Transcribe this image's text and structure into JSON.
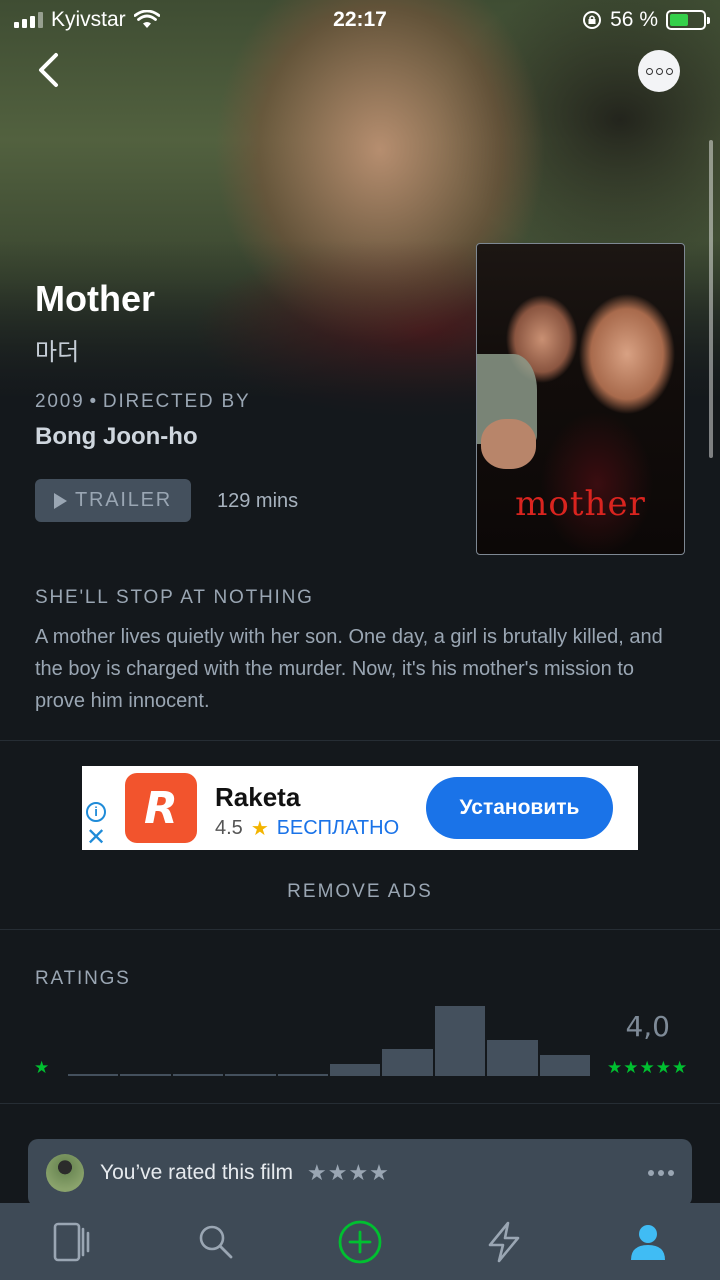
{
  "status_bar": {
    "carrier": "Kyivstar",
    "time": "22:17",
    "battery_percent": "56 %",
    "battery_level": 0.56
  },
  "film": {
    "title": "Mother",
    "original_title": "마더",
    "year": "2009",
    "directed_by_label": "DIRECTED BY",
    "director": "Bong Joon-ho",
    "trailer_label": "TRAILER",
    "runtime": "129 mins",
    "poster_title": "mother",
    "tagline": "SHE'LL STOP AT NOTHING",
    "synopsis": "A mother lives quietly with her son. One day, a girl is brutally killed, and the boy is charged with the murder. Now, it's his mother's mission to prove him innocent."
  },
  "ad": {
    "app_name": "Raketa",
    "rating": "4.5",
    "price": "БЕСПЛАТНО",
    "cta": "Установить",
    "info_icon": "info-icon",
    "close_icon": "close-icon",
    "remove_ads_label": "REMOVE ADS"
  },
  "ratings": {
    "label": "RATINGS",
    "average": "4,0",
    "min_stars": "★",
    "max_stars": "★★★★★",
    "histogram_levels": [
      0.02,
      0.02,
      0.02,
      0.02,
      0.02,
      0.17,
      0.38,
      1.0,
      0.52,
      0.3
    ]
  },
  "user_rating": {
    "text": "You’ve rated this film",
    "stars": "★★★★"
  },
  "tab_bar": {
    "tabs": [
      "films-tab",
      "search-tab",
      "add-tab",
      "activity-tab",
      "profile-tab"
    ]
  },
  "colors": {
    "background": "#14181c",
    "accent_green": "#00c030",
    "panel": "#3e4a56",
    "muted_text": "#9aa6b3",
    "ad_blue": "#1a73e8",
    "profile_blue": "#40bcf4"
  }
}
